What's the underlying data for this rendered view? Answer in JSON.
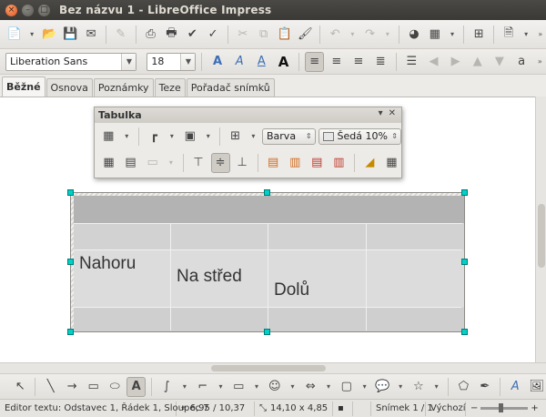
{
  "window": {
    "title": "Bez názvu 1 - LibreOffice Impress"
  },
  "toolbar": {
    "font_name": "Liberation Sans",
    "font_size": "18"
  },
  "tabs": [
    {
      "label": "Běžné",
      "active": true
    },
    {
      "label": "Osnova",
      "active": false
    },
    {
      "label": "Poznámky",
      "active": false
    },
    {
      "label": "Teze",
      "active": false
    },
    {
      "label": "Pořadač snímků",
      "active": false
    }
  ],
  "table_toolbar": {
    "title": "Tabulka",
    "area_style": "Barva",
    "area_color": "Šedá 10%"
  },
  "table": {
    "cells": {
      "top": "Nahoru",
      "center": "Na střed",
      "bottom": "Dolů"
    }
  },
  "status": {
    "edit_info": "Editor textu: Odstavec 1, Řádek 1, Sloupec 7",
    "position": "6,95 / 10,37",
    "size": "14,10 x 4,85",
    "slide": "Snímek 1 / 1",
    "layout": "Výchozí"
  },
  "colors": {
    "selection_handle": "#00d1c8",
    "title_bar": "#3c3b37",
    "table_header": "#b3b3b3"
  }
}
